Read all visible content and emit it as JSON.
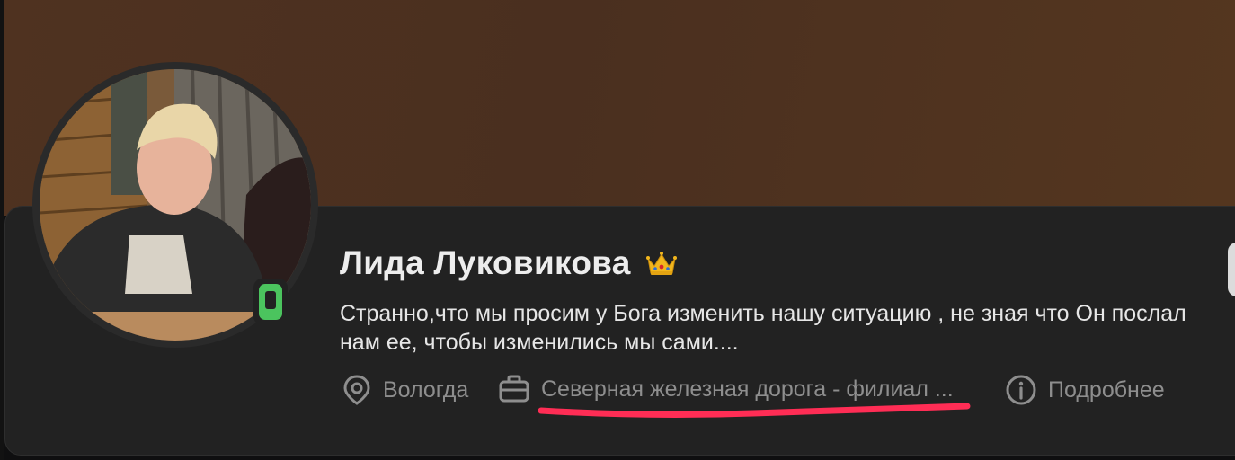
{
  "profile": {
    "name": "Лида Луковикова",
    "status_text": "Странно,что мы просим у Бога изменить нашу ситуацию , не зная что Он послал нам ее, чтобы изменились мы сами....",
    "city": "Вологда",
    "work": "Северная железная дорога - филиал ...",
    "more_label": "Подробнее"
  },
  "icons": {
    "crown": "crown-icon",
    "online": "mobile-online-icon",
    "location": "location-pin-icon",
    "work": "briefcase-icon",
    "info": "info-circle-icon"
  },
  "colors": {
    "cover": "#4e3221",
    "card_bg": "#222222",
    "online_green": "#4bc45e",
    "annotation_red": "#ff2d55",
    "meta_text": "#8e8e8e"
  }
}
